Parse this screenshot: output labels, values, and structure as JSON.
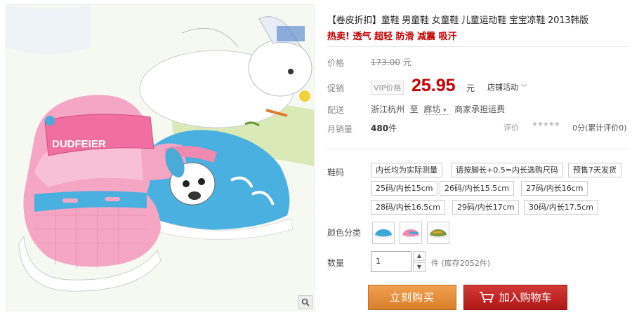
{
  "product": {
    "title": "【卷皮折扣】童鞋 男童鞋 女童鞋 儿童运动鞋 宝宝凉鞋 2013韩版",
    "subtitle": "热卖! 透气 超轻 防滑 减震 吸汗",
    "image_brand_text": "DUDFEIER"
  },
  "price": {
    "label": "价格",
    "original": "173.00",
    "unit": "元"
  },
  "promo": {
    "label": "促销",
    "vip_badge": "VIP价格",
    "price": "25.95",
    "unit": "元",
    "store_promo": "店铺活动"
  },
  "shipping": {
    "label": "配送",
    "from": "浙江杭州",
    "to_word": "至",
    "to": "廊坊",
    "fee_text": "商家承担运费"
  },
  "sales": {
    "label": "月销量",
    "count": "480",
    "count_unit": "件",
    "rating_label": "评价",
    "rating_score": "0分",
    "rating_link": "(累计评价0)"
  },
  "sizes": {
    "label": "鞋码",
    "notes": [
      "内长均为实际测量",
      "请按脚长+0.5=内长选购尺码",
      "预售7天发货"
    ],
    "options": [
      "25码/内长15cm",
      "26码/内长15.5cm",
      "27码/内长16cm",
      "28码/内长16.5cm",
      "29码/内长17cm",
      "30码/内长17.5cm"
    ]
  },
  "colors": {
    "label": "颜色分类",
    "swatches": [
      {
        "name": "blue-shoe",
        "color": "#3aa8d8"
      },
      {
        "name": "pink-shoe",
        "color": "#f08ab0"
      },
      {
        "name": "green-shoe",
        "color": "#7a9a3a"
      }
    ]
  },
  "quantity": {
    "label": "数量",
    "value": "1",
    "unit": "件",
    "stock": "(库存2052件)"
  },
  "actions": {
    "buy_now": "立刻购买",
    "add_to_cart": "加入购物车"
  },
  "icons": {
    "zoom": "magnifier-icon",
    "cart": "cart-icon",
    "dropdown": "chevron-down-icon",
    "stepper_up": "triangle-up-icon",
    "stepper_down": "triangle-down-icon"
  },
  "accent_colors": {
    "price_red": "#c40000",
    "buy_orange": "#e08a38",
    "cart_red": "#c02020"
  }
}
